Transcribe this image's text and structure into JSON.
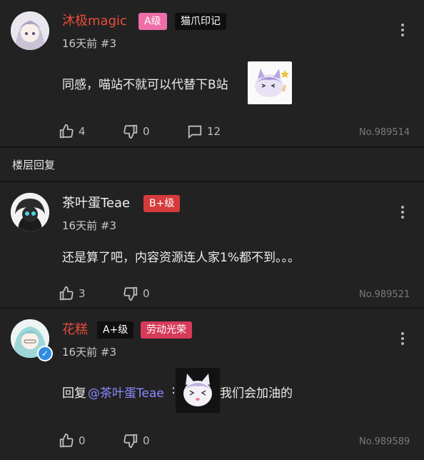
{
  "colors": {
    "background": "#222222",
    "name_red": "#ea4c3c",
    "badge_pink": "#ee6fa8",
    "badge_red": "#d63b3b",
    "badge_black": "#0f0f0f",
    "mention": "#8a8aff"
  },
  "comments": [
    {
      "username": "沐极magic",
      "level": "A级",
      "title_tag": "猫爪印记",
      "time": "16天前",
      "floor": "#3",
      "text": "同感，喵站不就可以代替下B站",
      "likes": "4",
      "dislikes": "0",
      "replies": "12",
      "id": "No.989514"
    },
    {
      "username": "茶叶蛋Teae",
      "level": "B+级",
      "time": "16天前",
      "floor": "#3",
      "text": "还是算了吧，内容资源连人家1%都不到。。。",
      "likes": "3",
      "dislikes": "0",
      "id": "No.989521"
    },
    {
      "username": "花糕",
      "level": "A+级",
      "title_tag": "劳动光荣",
      "time": "16天前",
      "floor": "#3",
      "reply_prefix": "回复",
      "mention": "@茶叶蛋Teae",
      "colon": ":",
      "text": "我们会加油的",
      "likes": "0",
      "dislikes": "0",
      "id": "No.989589"
    }
  ],
  "section": {
    "label": "楼层回复"
  },
  "icons": {
    "like": "thumbs-up-icon",
    "dislike": "thumbs-down-icon",
    "reply": "comment-icon",
    "more": "kebab-menu-icon",
    "verified": "verified-check-icon"
  }
}
